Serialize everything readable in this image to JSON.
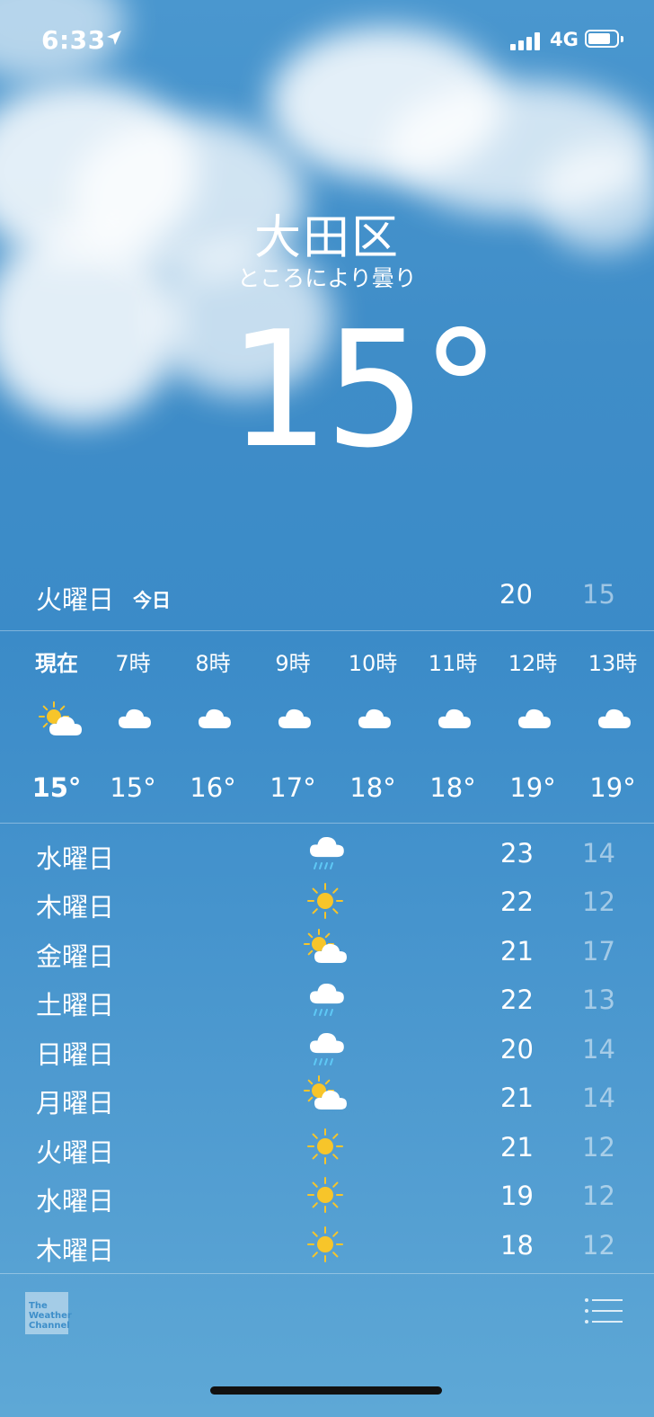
{
  "status_bar": {
    "time": "6:33",
    "network": "4G"
  },
  "location": {
    "city": "大田区",
    "condition": "ところにより曇り",
    "temperature": "15",
    "degree_symbol": "°"
  },
  "today": {
    "day": "火曜日",
    "tag": "今日",
    "high": "20",
    "low": "15"
  },
  "hourly": [
    {
      "label": "現在",
      "icon": "sun-cloud-icon",
      "temp": "15°"
    },
    {
      "label": "7時",
      "icon": "cloud-icon",
      "temp": "15°"
    },
    {
      "label": "8時",
      "icon": "cloud-icon",
      "temp": "16°"
    },
    {
      "label": "9時",
      "icon": "cloud-icon",
      "temp": "17°"
    },
    {
      "label": "10時",
      "icon": "cloud-icon",
      "temp": "18°"
    },
    {
      "label": "11時",
      "icon": "cloud-icon",
      "temp": "18°"
    },
    {
      "label": "12時",
      "icon": "cloud-icon",
      "temp": "19°"
    },
    {
      "label": "13時",
      "icon": "cloud-icon",
      "temp": "19°"
    }
  ],
  "daily": [
    {
      "day": "水曜日",
      "icon": "rain-cloud-icon",
      "high": "23",
      "low": "14"
    },
    {
      "day": "木曜日",
      "icon": "sun-icon",
      "high": "22",
      "low": "12"
    },
    {
      "day": "金曜日",
      "icon": "sun-cloud-icon",
      "high": "21",
      "low": "17"
    },
    {
      "day": "土曜日",
      "icon": "rain-cloud-icon",
      "high": "22",
      "low": "13"
    },
    {
      "day": "日曜日",
      "icon": "rain-cloud-icon",
      "high": "20",
      "low": "14"
    },
    {
      "day": "月曜日",
      "icon": "sun-cloud-icon",
      "high": "21",
      "low": "14"
    },
    {
      "day": "火曜日",
      "icon": "sun-icon",
      "high": "21",
      "low": "12"
    },
    {
      "day": "水曜日",
      "icon": "sun-icon",
      "high": "19",
      "low": "12"
    },
    {
      "day": "木曜日",
      "icon": "sun-icon",
      "high": "18",
      "low": "12"
    }
  ],
  "footer": {
    "logo_text": [
      "The",
      "Weather",
      "Channel"
    ]
  },
  "colors": {
    "sun": "#f7c52a",
    "rain": "#5ec8f5",
    "cloud": "#ffffff"
  }
}
